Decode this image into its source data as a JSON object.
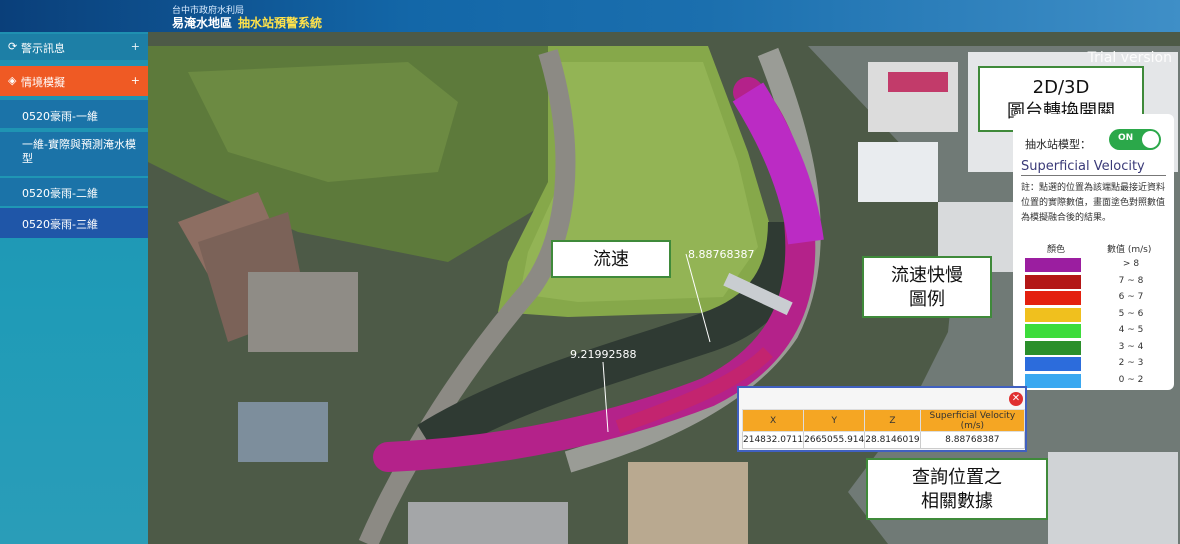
{
  "header": {
    "org": "台中市政府水利局",
    "title": "易淹水地區",
    "title_accent": "抽水站預警系統"
  },
  "sidebar": {
    "alerts": {
      "label": "警示訊息",
      "icon": "refresh-icon",
      "expand": "+"
    },
    "scenario": {
      "label": "情境模擬",
      "icon": "diamond-icon",
      "expand": "+"
    },
    "items": [
      {
        "label": "0520豪雨-一維"
      },
      {
        "label": "一維-實際與預測淹水模型"
      },
      {
        "label": "0520豪雨-二維"
      },
      {
        "label": "0520豪雨-三維"
      }
    ]
  },
  "map": {
    "watermark": "Trial version",
    "value_tag_1": "8.88768387",
    "value_tag_2": "9.21992588"
  },
  "callouts": {
    "speed": "流速",
    "legend_line1": "流速快慢",
    "legend_line2": "圖例",
    "switch_line1": "2D/3D",
    "switch_line2": "圖台轉換開關",
    "query_line1": "查詢位置之",
    "query_line2": "相關數據"
  },
  "legend": {
    "model_label": "抽水站模型：",
    "toggle_text": "ON",
    "title": "Superficial Velocity",
    "note": "註：點選的位置為該端點最接近資料位置的實際數值，畫面塗色對照數值為模擬融合後的結果。",
    "col_color": "顏色",
    "col_value": "數值 (m/s)",
    "ranges": [
      "> 8",
      "7 ~ 8",
      "6 ~ 7",
      "5 ~ 6",
      "4 ~ 5",
      "3 ~ 4",
      "2 ~ 3",
      "0 ~ 2"
    ],
    "colors": [
      "#9b1ea0",
      "#b31616",
      "#e3200f",
      "#f0c01e",
      "#3ddc3b",
      "#2b8f2b",
      "#2c6cdc",
      "#3aa8f0"
    ]
  },
  "query": {
    "headers": [
      "X",
      "Y",
      "Z",
      "Superficial Velocity (m/s)"
    ],
    "row": [
      "214832.0711",
      "2665055.914",
      "28.8146019",
      "8.88768387"
    ],
    "close": "✕"
  }
}
